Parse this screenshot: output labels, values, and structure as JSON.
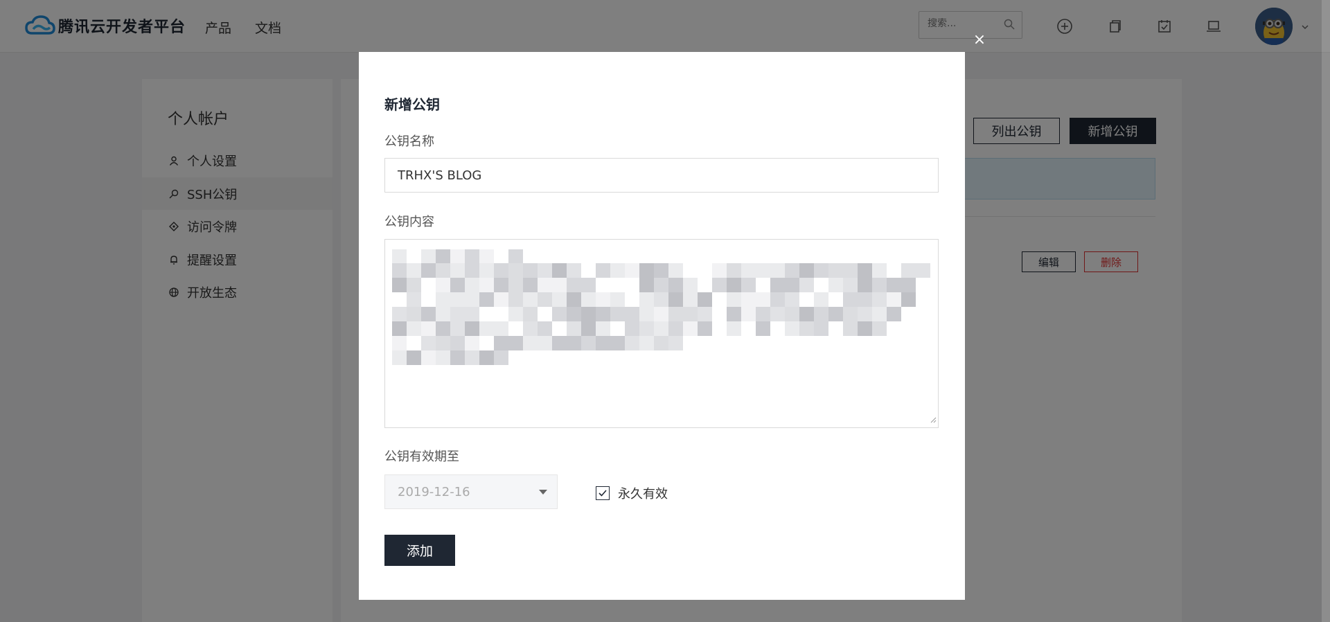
{
  "header": {
    "brand": "腾讯云开发者平台",
    "nav": [
      "产品",
      "文档"
    ],
    "search_placeholder": "搜索..."
  },
  "sidebar": {
    "title": "个人帐户",
    "items": [
      {
        "label": "个人设置",
        "icon": "user-icon"
      },
      {
        "label": "SSH公钥",
        "icon": "key-search-icon",
        "active": true
      },
      {
        "label": "访问令牌",
        "icon": "token-icon"
      },
      {
        "label": "提醒设置",
        "icon": "bell-icon"
      },
      {
        "label": "开放生态",
        "icon": "globe-icon"
      }
    ]
  },
  "main": {
    "list_button": "列出公钥",
    "add_button": "新增公钥",
    "edit_button": "编辑",
    "delete_button": "删除"
  },
  "modal": {
    "close": "×",
    "title": "新增公钥",
    "name_label": "公钥名称",
    "name_value": "TRHX'S BLOG",
    "content_label": "公钥内容",
    "expiry_label": "公钥有效期至",
    "expiry_value": "2019-12-16",
    "permanent_label": "永久有效",
    "permanent_checked": true,
    "submit": "添加"
  },
  "colors": {
    "primary_dark": "#1f2733",
    "danger": "#e02f2f",
    "info_bg": "#e3f3fb"
  }
}
